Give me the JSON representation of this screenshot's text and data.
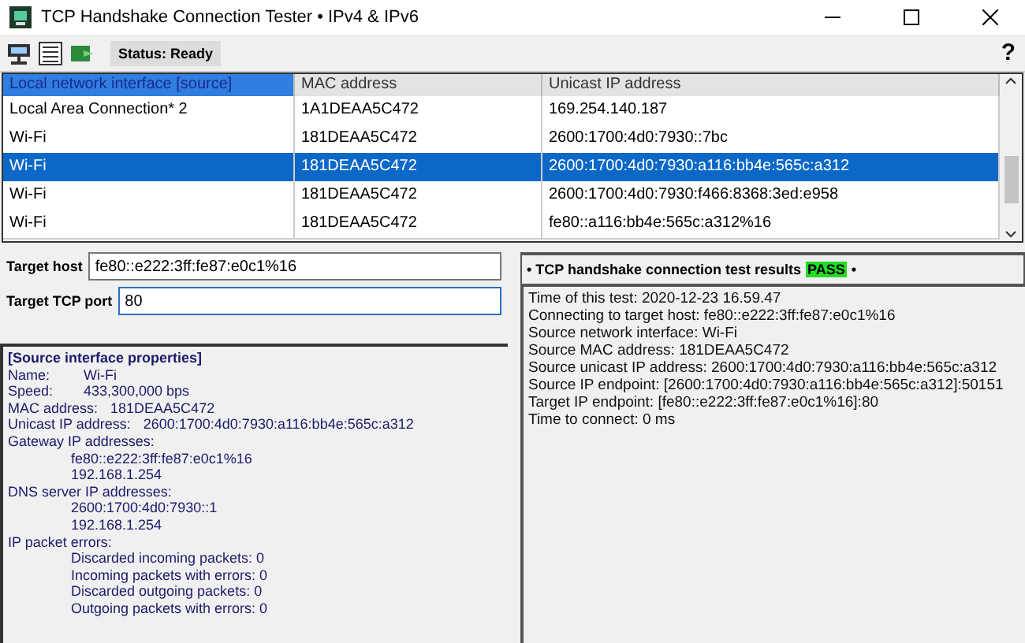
{
  "window": {
    "title": "TCP Handshake Connection Tester • IPv4 & IPv6"
  },
  "toolbar": {
    "status": "Status: Ready",
    "help": "?"
  },
  "table": {
    "columns": [
      {
        "label": "Local network interface [source]",
        "selected": true
      },
      {
        "label": "MAC address",
        "selected": false
      },
      {
        "label": "Unicast IP address",
        "selected": false
      }
    ],
    "rows": [
      {
        "cells": [
          "Local Area Connection* 2",
          "1A1DEAA5C472",
          "169.254.140.187"
        ],
        "selected": false
      },
      {
        "cells": [
          "Wi-Fi",
          "181DEAA5C472",
          "2600:1700:4d0:7930::7bc"
        ],
        "selected": false
      },
      {
        "cells": [
          "Wi-Fi",
          "181DEAA5C472",
          "2600:1700:4d0:7930:a116:bb4e:565c:a312"
        ],
        "selected": true
      },
      {
        "cells": [
          "Wi-Fi",
          "181DEAA5C472",
          "2600:1700:4d0:7930:f466:8368:3ed:e958"
        ],
        "selected": false
      },
      {
        "cells": [
          "Wi-Fi",
          "181DEAA5C472",
          "fe80::a116:bb4e:565c:a312%16"
        ],
        "selected": false
      }
    ]
  },
  "target": {
    "host_label": "Target host",
    "host": "fe80::e222:3ff:fe87:e0c1%16",
    "port_label": "Target TCP port",
    "port": "80"
  },
  "properties": {
    "title": "[Source interface properties]",
    "items": [
      {
        "label": "Name:",
        "value": "Wi-Fi"
      },
      {
        "label": "Speed:",
        "value": "433,300,000 bps"
      },
      {
        "label": "MAC address:",
        "value": "181DEAA5C472"
      },
      {
        "label": "Unicast IP address:",
        "value": "2600:1700:4d0:7930:a116:bb4e:565c:a312"
      },
      {
        "label": "Gateway IP addresses:",
        "children": [
          "fe80::e222:3ff:fe87:e0c1%16",
          "192.168.1.254"
        ]
      },
      {
        "label": "DNS server IP addresses:",
        "children": [
          "2600:1700:4d0:7930::1",
          "192.168.1.254"
        ]
      },
      {
        "label": "IP packet errors:",
        "children": [
          "Discarded incoming packets: 0",
          "Incoming packets with errors: 0",
          "Discarded outgoing packets: 0",
          "Outgoing packets with errors: 0"
        ]
      }
    ]
  },
  "results": {
    "header_prefix": "• TCP handshake connection test results",
    "result": "PASS",
    "header_suffix": "•",
    "passed": true,
    "lines": [
      "Time of this test: 2020-12-23 16.59.47",
      "Connecting to target host: fe80::e222:3ff:fe87:e0c1%16",
      "Source network interface: Wi-Fi",
      "Source MAC address: 181DEAA5C472",
      "Source unicast IP address: 2600:1700:4d0:7930:a116:bb4e:565c:a312",
      "Source IP endpoint: [2600:1700:4d0:7930:a116:bb4e:565c:a312]:50151",
      "Target IP endpoint: [fe80::e222:3ff:fe87:e0c1%16]:80",
      "Time to connect: 0 ms"
    ]
  }
}
